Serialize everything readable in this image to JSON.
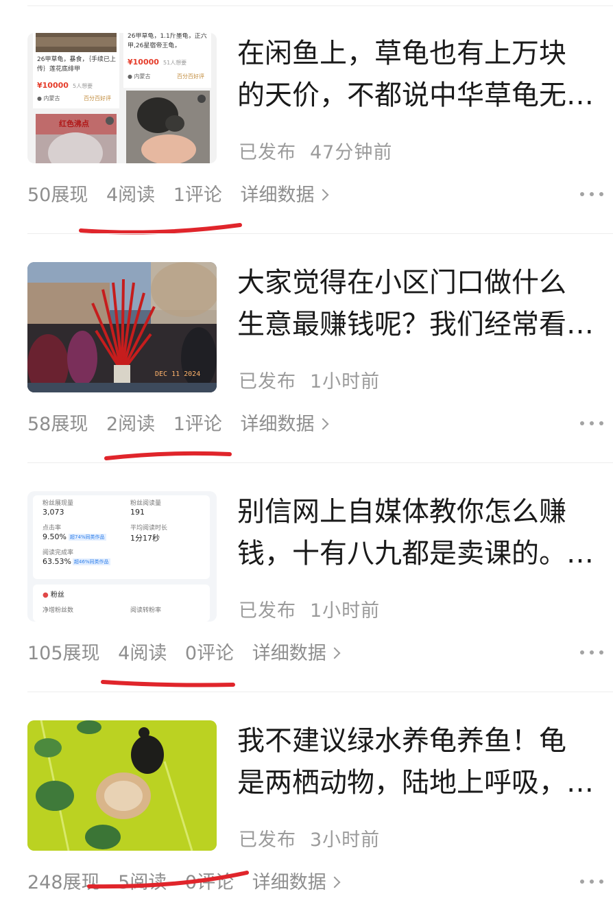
{
  "articles": [
    {
      "title_line1": "在闲鱼上，草龟也有上万块",
      "title_line2": "的天价，不都说中华草龟无…",
      "status": "已发布",
      "time": "47分钟前",
      "impressions": "50展现",
      "reads": "4阅读",
      "comments": "1评论",
      "detail": "详细数据",
      "thumb": {
        "item1_desc": "26甲草龟，暴食，｛手续已上传｝莲花底绯甲",
        "item1_price": "¥10000",
        "item1_wants": "5人想要",
        "item1_seller": "内蒙古",
        "item1_tag": "百分百好评",
        "item2_desc": "26甲草龟，1.1斤墨龟，正六甲,26星宿帝王龟，",
        "item2_price": "¥10000",
        "item2_wants": "51人想要",
        "item2_seller": "内蒙古",
        "item2_tag": "百分百好评",
        "item3_label": "红色沸点"
      }
    },
    {
      "title_line1": "大家觉得在小区门口做什么",
      "title_line2": "生意最赚钱呢？我们经常看…",
      "status": "已发布",
      "time": "1小时前",
      "impressions": "58展现",
      "reads": "2阅读",
      "comments": "1评论",
      "detail": "详细数据",
      "thumb": {
        "date_stamp": "DEC 11 2024"
      }
    },
    {
      "title_line1": "别信网上自媒体教你怎么赚",
      "title_line2": "钱，十有八九都是卖课的。…",
      "status": "已发布",
      "time": "1小时前",
      "impressions": "105展现",
      "reads": "4阅读",
      "comments": "0评论",
      "detail": "详细数据",
      "thumb": {
        "fans_impressions_label": "粉丝展现量",
        "fans_impressions_value": "3,073",
        "fans_reads_label": "粉丝阅读量",
        "fans_reads_value": "191",
        "ctr_label": "点击率",
        "ctr_value": "9.50%",
        "ctr_badge": "超74%同类作品",
        "avg_time_label": "平均阅读时长",
        "avg_time_value": "1分17秒",
        "completion_label": "阅读完成率",
        "completion_value": "63.53%",
        "completion_badge": "超46%同类作品",
        "fans_section": "粉丝",
        "net_fans_label": "净增粉丝数",
        "read_conv_label": "阅读转粉率"
      }
    },
    {
      "title_line1": "我不建议绿水养龟养鱼！龟",
      "title_line2": "是两栖动物，陆地上呼吸，…",
      "status": "已发布",
      "time": "3小时前",
      "impressions": "248展现",
      "reads": "5阅读",
      "comments": "0评论",
      "detail": "详细数据",
      "thumb": {}
    }
  ],
  "colors": {
    "title": "#1a1a1a",
    "meta": "#9b9b9b",
    "annotation_red": "#e0252b"
  }
}
